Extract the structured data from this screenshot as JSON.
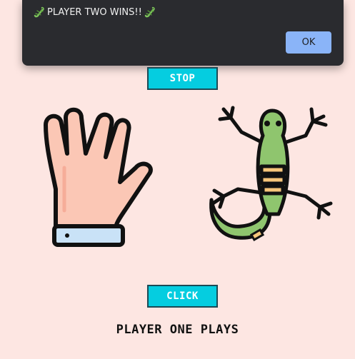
{
  "dialog": {
    "message": "PLAYER TWO WINS!!",
    "ok_label": "OK",
    "icon": "lizard-emoji"
  },
  "controls": {
    "stop_label": "STOP",
    "click_label": "CLICK"
  },
  "status": {
    "text": "PLAYER ONE PLAYS"
  },
  "players": {
    "one_choice_icon": "spock-hand-icon",
    "two_choice_icon": "lizard-icon"
  },
  "colors": {
    "background": "#fde6e2",
    "button": "#05cde0",
    "dialog": "#2a2b2f",
    "ok_button": "#8ab4f8"
  }
}
